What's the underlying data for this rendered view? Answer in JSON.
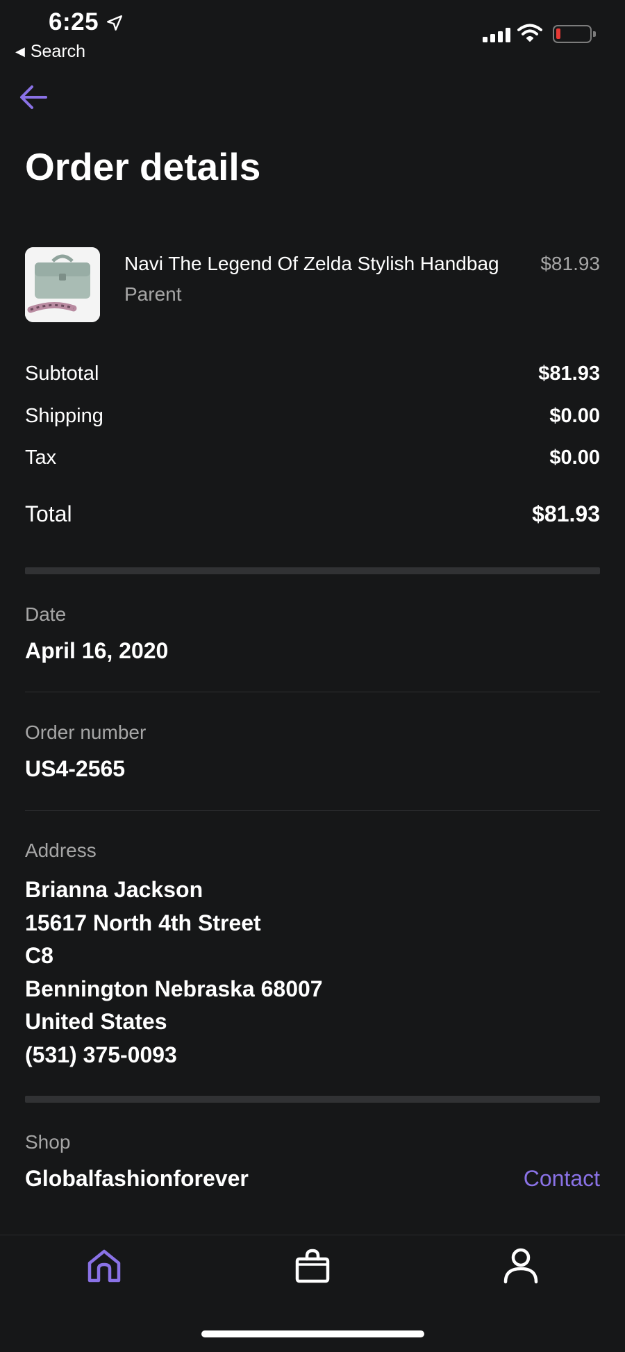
{
  "status_bar": {
    "time": "6:25",
    "back_app_label": "Search",
    "battery_color": "#e53935"
  },
  "header": {
    "title": "Order details",
    "back_icon": "arrow-left-icon",
    "accent_color": "#8a72e6"
  },
  "product": {
    "name": "Navi The Legend Of Zelda Stylish Handbag",
    "variant": "Parent",
    "price": "$81.93"
  },
  "summary": {
    "subtotal_label": "Subtotal",
    "subtotal_value": "$81.93",
    "shipping_label": "Shipping",
    "shipping_value": "$0.00",
    "tax_label": "Tax",
    "tax_value": "$0.00",
    "total_label": "Total",
    "total_value": "$81.93"
  },
  "details": {
    "date_label": "Date",
    "date_value": "April 16, 2020",
    "order_number_label": "Order number",
    "order_number_value": "US4-2565",
    "address_label": "Address",
    "address_lines": {
      "name": "Brianna Jackson",
      "street": "15617 North 4th Street",
      "unit": "C8",
      "city_state_zip": "Bennington Nebraska 68007",
      "country": "United States",
      "phone": "(531) 375-0093"
    }
  },
  "shop": {
    "label": "Shop",
    "name": "Globalfashionforever",
    "contact_label": "Contact"
  },
  "tab_bar": {
    "tabs": [
      {
        "icon": "home-icon",
        "active": true
      },
      {
        "icon": "shopping-bag-icon",
        "active": false
      },
      {
        "icon": "user-icon",
        "active": false
      }
    ]
  }
}
